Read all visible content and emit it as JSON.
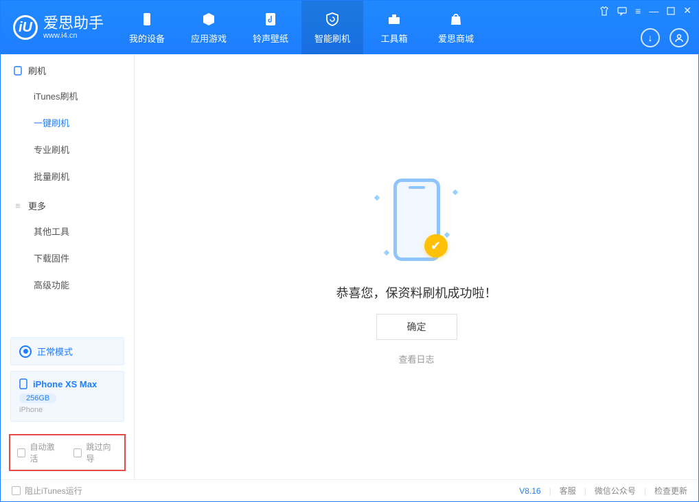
{
  "app": {
    "name": "爱思助手",
    "site": "www.i4.cn",
    "logo_letter": "iU"
  },
  "nav": {
    "device": "我的设备",
    "apps": "应用游戏",
    "ringtone": "铃声壁纸",
    "flash": "智能刷机",
    "toolbox": "工具箱",
    "store": "爱思商城"
  },
  "sidebar": {
    "group_flash": "刷机",
    "items_flash": {
      "itunes": "iTunes刷机",
      "oneclick": "一键刷机",
      "pro": "专业刷机",
      "batch": "批量刷机"
    },
    "group_more": "更多",
    "items_more": {
      "other": "其他工具",
      "firmware": "下载固件",
      "advanced": "高级功能"
    }
  },
  "mode": {
    "label": "正常模式"
  },
  "device": {
    "name": "iPhone XS Max",
    "storage": "256GB",
    "type": "iPhone"
  },
  "checks": {
    "auto_activate": "自动激活",
    "skip_guide": "跳过向导"
  },
  "main": {
    "success": "恭喜您，保资料刷机成功啦！",
    "ok": "确定",
    "view_log": "查看日志"
  },
  "status": {
    "block_itunes": "阻止iTunes运行",
    "version": "V8.16",
    "support": "客服",
    "wechat": "微信公众号",
    "update": "检查更新"
  }
}
